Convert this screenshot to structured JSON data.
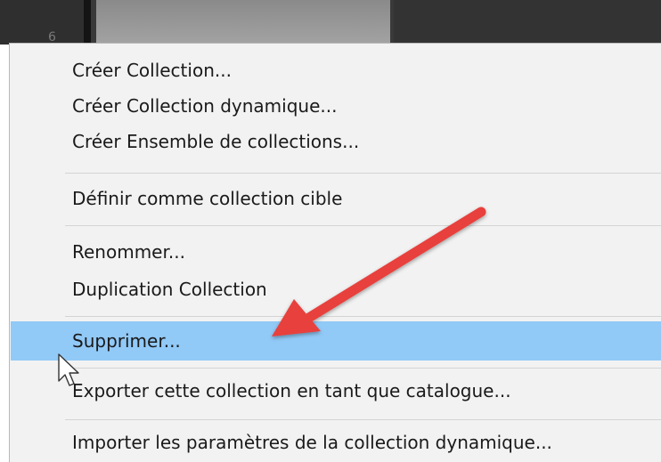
{
  "background": {
    "panel_number": "6"
  },
  "menu": {
    "items": [
      {
        "label": "Créer Collection..."
      },
      {
        "label": "Créer Collection dynamique..."
      },
      {
        "label": "Créer Ensemble de collections..."
      },
      {
        "label": "Définir comme collection cible"
      },
      {
        "label": "Renommer..."
      },
      {
        "label": "Duplication Collection"
      },
      {
        "label": "Supprimer...",
        "highlighted": true
      },
      {
        "label": "Exporter cette collection en tant que catalogue..."
      },
      {
        "label": "Importer les paramètres de la collection dynamique..."
      }
    ]
  },
  "colors": {
    "menu_background": "#f2f2f2",
    "highlight": "#91c9f7",
    "arrow": "#e8413c",
    "app_background": "#3a3a3a"
  },
  "icons": {
    "annotation": "red-arrow-icon",
    "cursor": "mouse-pointer-icon"
  }
}
